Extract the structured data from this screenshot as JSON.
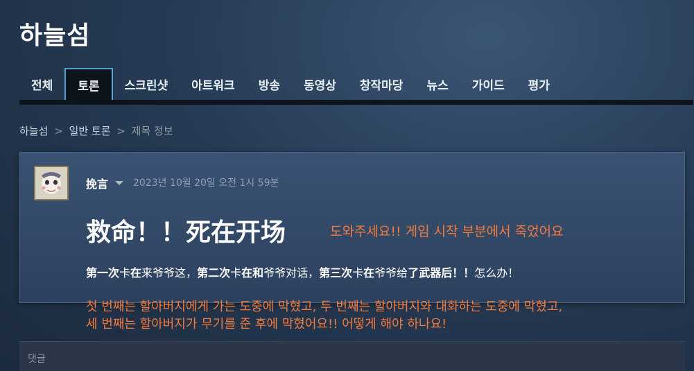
{
  "page": {
    "title": "하늘섬"
  },
  "tabs": [
    "전체",
    "토론",
    "스크린샷",
    "아트워크",
    "방송",
    "동영상",
    "창작마당",
    "뉴스",
    "가이드",
    "평가"
  ],
  "breadcrumb": {
    "item1": "하늘섬",
    "item2": "일반 토론",
    "item3": "제목 정보",
    "sep": ">"
  },
  "post": {
    "author": "挽言",
    "date": "2023년 10월 20일 오전 1시 59분",
    "title": "救命！！死在开场",
    "body_runs": [
      {
        "text": "第一次",
        "b": true
      },
      {
        "text": "卡",
        "b": false
      },
      {
        "text": "在",
        "b": true
      },
      {
        "text": "来爷爷这，",
        "b": false
      },
      {
        "text": "第二次",
        "b": true
      },
      {
        "text": "卡",
        "b": false
      },
      {
        "text": "在和",
        "b": true
      },
      {
        "text": "爷爷对话，",
        "b": false
      },
      {
        "text": "第三次",
        "b": true
      },
      {
        "text": "卡",
        "b": false
      },
      {
        "text": "在",
        "b": true
      },
      {
        "text": "爷爷给",
        "b": false
      },
      {
        "text": "了武器后！！",
        "b": true
      },
      {
        "text": "怎么办！",
        "b": false
      }
    ]
  },
  "annotations": {
    "top": "도와주세요!! 게임 시작 부분에서 죽었어요",
    "bottom_line1": "첫 번째는 할아버지에게 가는 도중에 막혔고, 두 번째는 할아버지와 대화하는 도중에 막혔고,",
    "bottom_line2": "세 번째는 할아버지가 무기를 준 후에 막혔어요!! 어떻게 해야 하나요!",
    "color": "#f17a3c"
  },
  "comments": {
    "label": "댓글"
  },
  "colors": {
    "tab_active_border": "#4fa3d8",
    "tab_bar": "#0e141b",
    "card_bg": "#344b6b"
  }
}
